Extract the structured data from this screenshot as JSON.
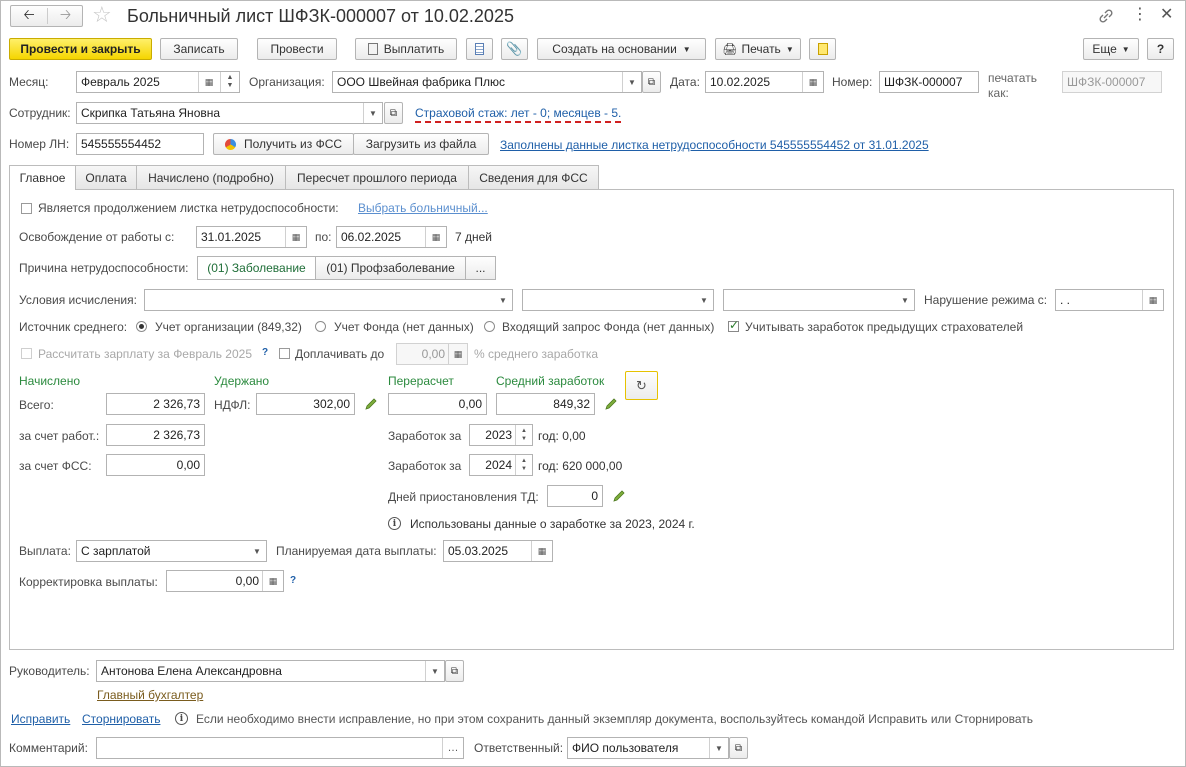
{
  "title": "Больничный лист ШФЗК-000007 от 10.02.2025",
  "toolbar": {
    "post_close": "Провести и закрыть",
    "save": "Записать",
    "post": "Провести",
    "pay": "Выплатить",
    "create_based": "Создать на основании",
    "print": "Печать",
    "more": "Еще",
    "help": "?"
  },
  "header": {
    "month_label": "Месяц:",
    "month_value": "Февраль 2025",
    "org_label": "Организация:",
    "org_value": "ООО Швейная фабрика Плюс",
    "date_label": "Дата:",
    "date_value": "10.02.2025",
    "number_label": "Номер:",
    "number_value": "ШФЗК-000007",
    "print_as_label_1": "печатать",
    "print_as_label_2": "как:",
    "print_as_value": "ШФЗК-000007",
    "employee_label": "Сотрудник:",
    "employee_value": "Скрипка Татьяна Яновна",
    "insurance_link": "Страховой стаж: лет - 0; месяцев - 5.",
    "ln_label": "Номер ЛН:",
    "ln_value": "545555554452",
    "get_fss": "Получить из ФСС",
    "load_file": "Загрузить из файла",
    "filled_link": "Заполнены данные листка нетрудоспособности 545555554452 от 31.01.2025"
  },
  "tabs": [
    "Главное",
    "Оплата",
    "Начислено (подробно)",
    "Пересчет прошлого периода",
    "Сведения для ФСС"
  ],
  "main": {
    "continuation_label": "Является продолжением листка нетрудоспособности:",
    "choose_sick_link": "Выбрать больничный...",
    "release_label": "Освобождение от работы с:",
    "release_from": "31.01.2025",
    "release_to_label": "по:",
    "release_to": "06.02.2025",
    "days": "7 дней",
    "reason_label": "Причина нетрудоспособности:",
    "reason_1": "(01) Заболевание",
    "reason_2": "(01) Профзаболевание",
    "reason_more": "...",
    "conditions_label": "Условия исчисления:",
    "violation_label": "Нарушение режима с:",
    "violation_value": " .  .",
    "avg_source_label": "Источник среднего:",
    "radio_1": "Учет организации (849,32)",
    "radio_2": "Учет Фонда (нет данных)",
    "radio_3": "Входящий запрос Фонда (нет данных)",
    "consider_prev": "Учитывать заработок предыдущих страхователей",
    "calc_salary": "Рассчитать зарплату за Февраль 2025",
    "q": "?",
    "extra_pay": "Доплачивать до",
    "extra_value": "0,00",
    "extra_suffix": "% среднего заработка",
    "accrued_head": "Начислено",
    "withheld_head": "Удержано",
    "recalc_head": "Перерасчет",
    "avg_head": "Средний заработок",
    "total_label": "Всего:",
    "total_value": "2 326,73",
    "ndfl_label": "НДФЛ:",
    "ndfl_value": "302,00",
    "recalc_value": "0,00",
    "avg_value": "849,32",
    "employer_label": "за счет работ.:",
    "employer_value": "2 326,73",
    "fss_label": "за счет ФСС:",
    "fss_value": "0,00",
    "earn_label_1": "Заработок за",
    "earn_year_1": "2023",
    "earn_text_1": "год: 0,00",
    "earn_label_2": "Заработок за",
    "earn_year_2": "2024",
    "earn_text_2": "год: 620 000,00",
    "suspend_label": "Дней приостановления ТД:",
    "suspend_value": "0",
    "used_info": "Использованы данные о заработке за  2023,  2024 г.",
    "payout_label": "Выплата:",
    "payout_value": "С зарплатой",
    "planned_label": "Планируемая дата выплаты:",
    "planned_value": "05.03.2025",
    "correction_label": "Корректировка выплаты:",
    "correction_value": "0,00"
  },
  "footer": {
    "head_label": "Руководитель:",
    "head_value": "Антонова Елена Александровна",
    "chief_accountant_link": "Главный бухгалтер",
    "fix_link": "Исправить",
    "storno_link": "Сторнировать",
    "info_text": "Если необходимо внести исправление, но при этом сохранить данный экземпляр документа, воспользуйтесь командой Исправить или Сторнировать",
    "comment_label": "Комментарий:",
    "comment_value": "",
    "responsible_label": "Ответственный:",
    "responsible_value": "ФИО пользователя"
  },
  "colors": {
    "primary_button": "#f5d500",
    "link": "#1f5fa8",
    "section_green": "#2b8a3e"
  }
}
